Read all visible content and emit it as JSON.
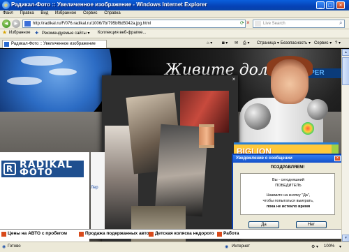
{
  "window": {
    "title": "Радикал-Фото :: Увеличенное изображение - Windows Internet Explorer"
  },
  "menu": [
    "Файл",
    "Правка",
    "Вид",
    "Избранное",
    "Сервис",
    "Справка"
  ],
  "address": {
    "url": "http://radikal.ru/F/076.radikal.ru/1006/7b/795bf6d5042a.jpg.html",
    "search_placeholder": "Live Search"
  },
  "favorites_bar": {
    "favorites_label": "Избранное",
    "item1": "Рекомендуемые сайты ▾",
    "item2": "Коллекция веб-фрагме..."
  },
  "tab": {
    "label": "Радикал-Фото :: Увеличенное изображение"
  },
  "command_bar": {
    "page": "Страница ▾",
    "safety": "Безопасность ▾",
    "tools": "Сервис ▾"
  },
  "content": {
    "slogan": "Живите дольше!",
    "per_banner": "PER",
    "radikal_logo_line1": "RADIKAL",
    "radikal_logo_line2": "ФОТО",
    "biglion": "BIGLION",
    "side_text": "Лер"
  },
  "notification": {
    "title": "Уведомление о сообщении",
    "congrats": "ПОЗДРАВЛЯЕМ!",
    "line1": "Вы - сегодняшний",
    "line2": "ПОБЕДИТЕЛЬ",
    "line3": "Нажмите на кнопку \"Да\",",
    "line4": "чтобы попытаться выиграть,",
    "line5": "пока не истекло время",
    "yes": "Да",
    "no": "Нет"
  },
  "ticker": {
    "item1": "Цены на АВТО с пробегом",
    "item2": "Продажа подержанных авто",
    "item3": "Детская коляска недорого",
    "item4": "Работа"
  },
  "status": {
    "left": "Готово",
    "zone": "Интернет",
    "zoom": "100%"
  }
}
